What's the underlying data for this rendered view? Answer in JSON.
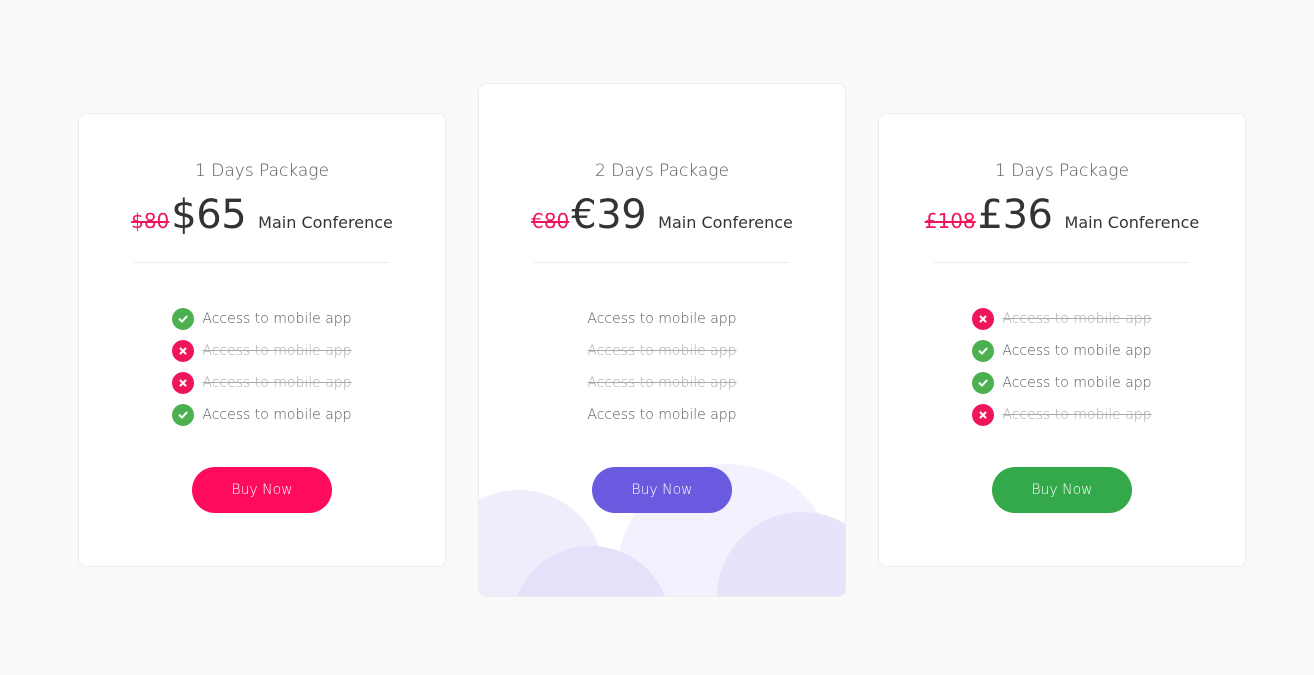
{
  "colors": {
    "background": "#f9f9f9",
    "card": "#ffffff",
    "old_price": "#f0155a",
    "check": "#4caf50",
    "cross": "#f0155a",
    "button_pink": "#ff0b5e",
    "button_purple": "#6a5ae0",
    "button_green": "#34a94c"
  },
  "cards": [
    {
      "title": "1 Days Package",
      "old_price": "$80",
      "new_price": "$65",
      "label": "Main Conference",
      "button": "Buy Now",
      "features": [
        {
          "text": "Access to mobile app",
          "status": "included",
          "icon": "check-icon"
        },
        {
          "text": "Access to mobile app",
          "status": "excluded",
          "icon": "cross-icon"
        },
        {
          "text": "Access to mobile app",
          "status": "excluded",
          "icon": "cross-icon"
        },
        {
          "text": "Access to mobile app",
          "status": "included",
          "icon": "check-icon"
        }
      ]
    },
    {
      "title": "2 Days Package",
      "old_price": "€80",
      "new_price": "€39",
      "label": "Main Conference",
      "button": "Buy Now",
      "features": [
        {
          "text": "Access to mobile app",
          "status": "included"
        },
        {
          "text": "Access to mobile app",
          "status": "excluded"
        },
        {
          "text": "Access to mobile app",
          "status": "excluded"
        },
        {
          "text": "Access to mobile app",
          "status": "included"
        }
      ]
    },
    {
      "title": "1 Days Package",
      "old_price": "£108",
      "new_price": "£36",
      "label": "Main Conference",
      "button": "Buy Now",
      "features": [
        {
          "text": "Access to mobile app",
          "status": "excluded",
          "icon": "cross-icon"
        },
        {
          "text": "Access to mobile app",
          "status": "included",
          "icon": "check-icon"
        },
        {
          "text": "Access to mobile app",
          "status": "included",
          "icon": "check-icon"
        },
        {
          "text": "Access to mobile app",
          "status": "excluded",
          "icon": "cross-icon"
        }
      ]
    }
  ]
}
